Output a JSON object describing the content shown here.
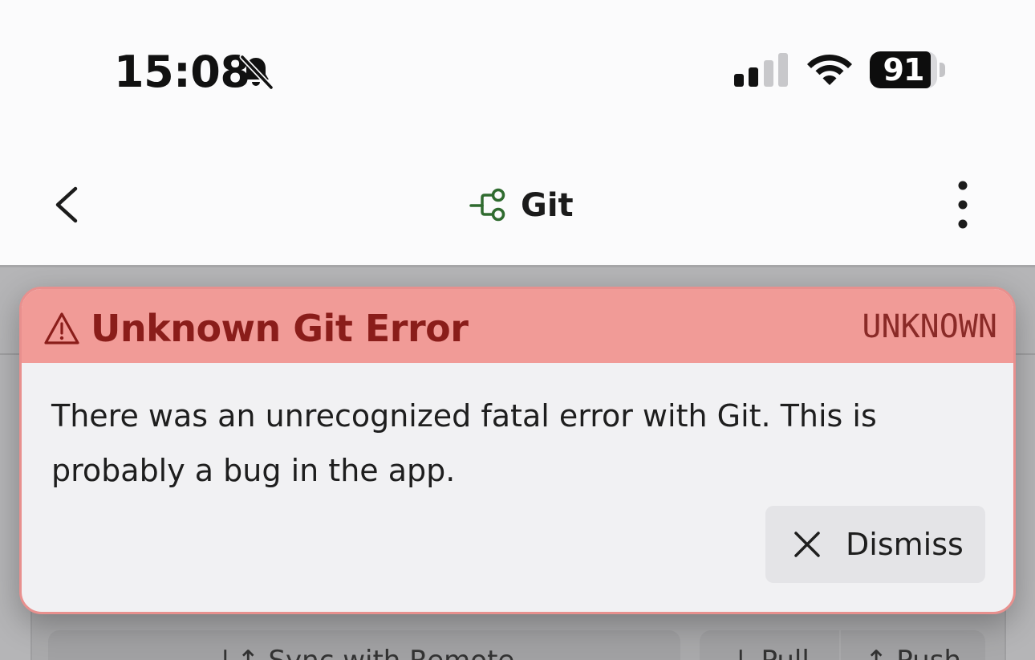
{
  "status_bar": {
    "time": "15:08",
    "battery": "91",
    "battery_level_percent": 91,
    "icons": [
      "bell-slash-icon",
      "cellular-signal-icon",
      "wifi-icon",
      "battery-icon"
    ]
  },
  "header": {
    "title": "Git",
    "icons": [
      "chevron-left-icon",
      "git-branch-icon",
      "more-vertical-icon"
    ]
  },
  "error": {
    "title": "Unknown Git Error",
    "code": "UNKNOWN",
    "message": "There was an unrecognized fatal error with Git. This is probably a bug in the app.",
    "dismiss_label": "Dismiss",
    "icons": [
      "warning-icon",
      "close-icon"
    ]
  },
  "background": {
    "sync_label": "↓↑ Sync with Remote",
    "pull_label": "↓ Pull",
    "push_label": "↑ Push"
  },
  "colors": {
    "error_header_bg": "#f19b97",
    "error_title": "#8a1d1a",
    "error_border": "#e8908e",
    "git_icon": "#2f6b2f",
    "dialog_bg": "#f1f1f3"
  }
}
